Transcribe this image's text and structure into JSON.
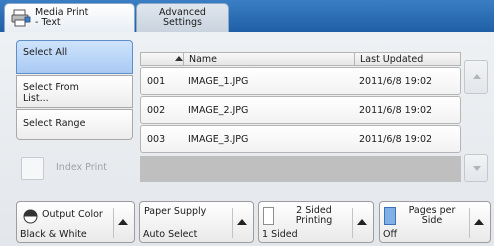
{
  "tabs": {
    "media_print": "Media Print\n- Text",
    "advanced_settings": "Advanced\nSettings"
  },
  "selection": {
    "select_all": "Select All",
    "select_from_list": "Select From\nList...",
    "select_range": "Select Range"
  },
  "index_print": {
    "label": "Index Print"
  },
  "table": {
    "headers": {
      "name": "Name",
      "last_updated": "Last Updated"
    },
    "rows": [
      {
        "num": "001",
        "name": "IMAGE_1.JPG",
        "updated": "2011/6/8 19:02"
      },
      {
        "num": "002",
        "name": "IMAGE_2.JPG",
        "updated": "2011/6/8 19:02"
      },
      {
        "num": "003",
        "name": "IMAGE_3.JPG",
        "updated": "2011/6/8 19:02"
      }
    ]
  },
  "bottom": {
    "output_color": {
      "title": "Output Color",
      "value": "Black & White"
    },
    "paper_supply": {
      "title": "Paper Supply",
      "value": "Auto Select"
    },
    "two_sided": {
      "title": "2 Sided\nPrinting",
      "value": "1 Sided"
    },
    "pages_per_side": {
      "title": "Pages per\nSide",
      "value": "Off"
    }
  },
  "icons": {
    "tab": "media-print-icon",
    "sort": "sort-ascending-icon",
    "color": "output-color-icon",
    "two_sided": "page-icon",
    "pages_per_side": "pages-per-side-icon"
  },
  "colors": {
    "tabbar": "#2a6db5",
    "selected": "#a9caf3",
    "disabled_text": "#9ea3a8"
  }
}
